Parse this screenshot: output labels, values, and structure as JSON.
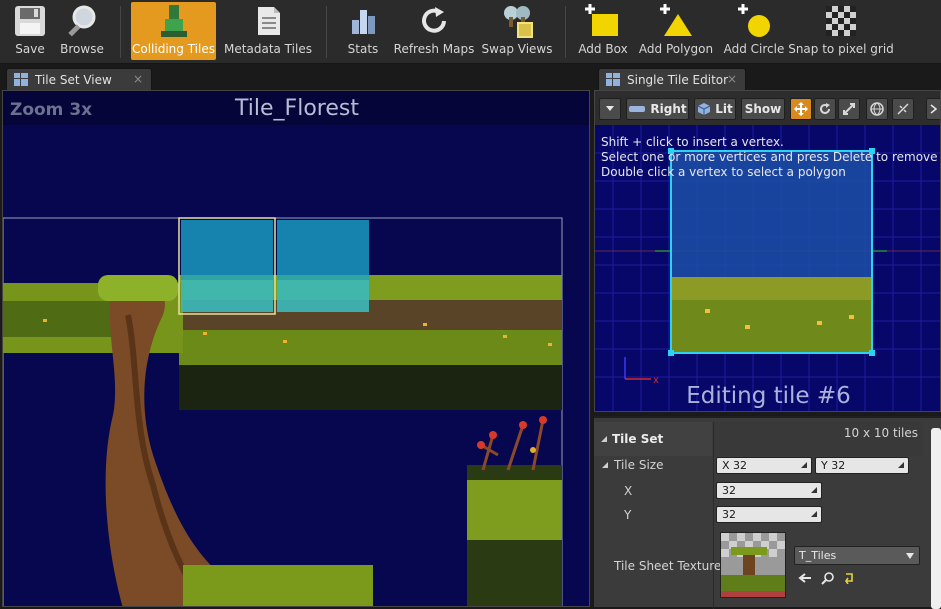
{
  "toolbar": {
    "save": "Save",
    "browse": "Browse",
    "colliding_tiles": "Colliding Tiles",
    "metadata_tiles": "Metadata Tiles",
    "stats": "Stats",
    "refresh_maps": "Refresh Maps",
    "swap_views": "Swap Views",
    "add_box": "Add Box",
    "add_polygon": "Add Polygon",
    "add_circle": "Add Circle",
    "snap_to_pixel_grid": "Snap to pixel grid"
  },
  "tabs": {
    "tile_set_view": "Tile Set View",
    "single_tile_editor": "Single Tile Editor",
    "close_glyph": "×"
  },
  "tile_set_view": {
    "zoom": "Zoom 3x",
    "title": "Tile_Florest"
  },
  "single_tile_editor": {
    "view_mode": "Right",
    "lighting": "Lit",
    "show": "Show",
    "info_lines": [
      "Shift + click to insert a vertex.",
      "Select one or more vertices and press Delete to remove them",
      "Double click a vertex to select a polygon"
    ],
    "editing_label": "Editing tile #6"
  },
  "details": {
    "category": "Tile Set",
    "tile_count": "10 x 10 tiles",
    "tile_size_label": "Tile Size",
    "tile_size_x": "X  32",
    "tile_size_y": "Y  32",
    "x_label": "X",
    "x_value": "32",
    "y_label": "Y",
    "y_value": "32",
    "tile_sheet_texture_label": "Tile Sheet Texture",
    "texture_name": "T_Tiles"
  },
  "colors": {
    "accent": "#e49a1f",
    "viewport_bg": "#07074f",
    "selection_cyan": "#2fa8e0",
    "grass": "#7b9a1c"
  }
}
